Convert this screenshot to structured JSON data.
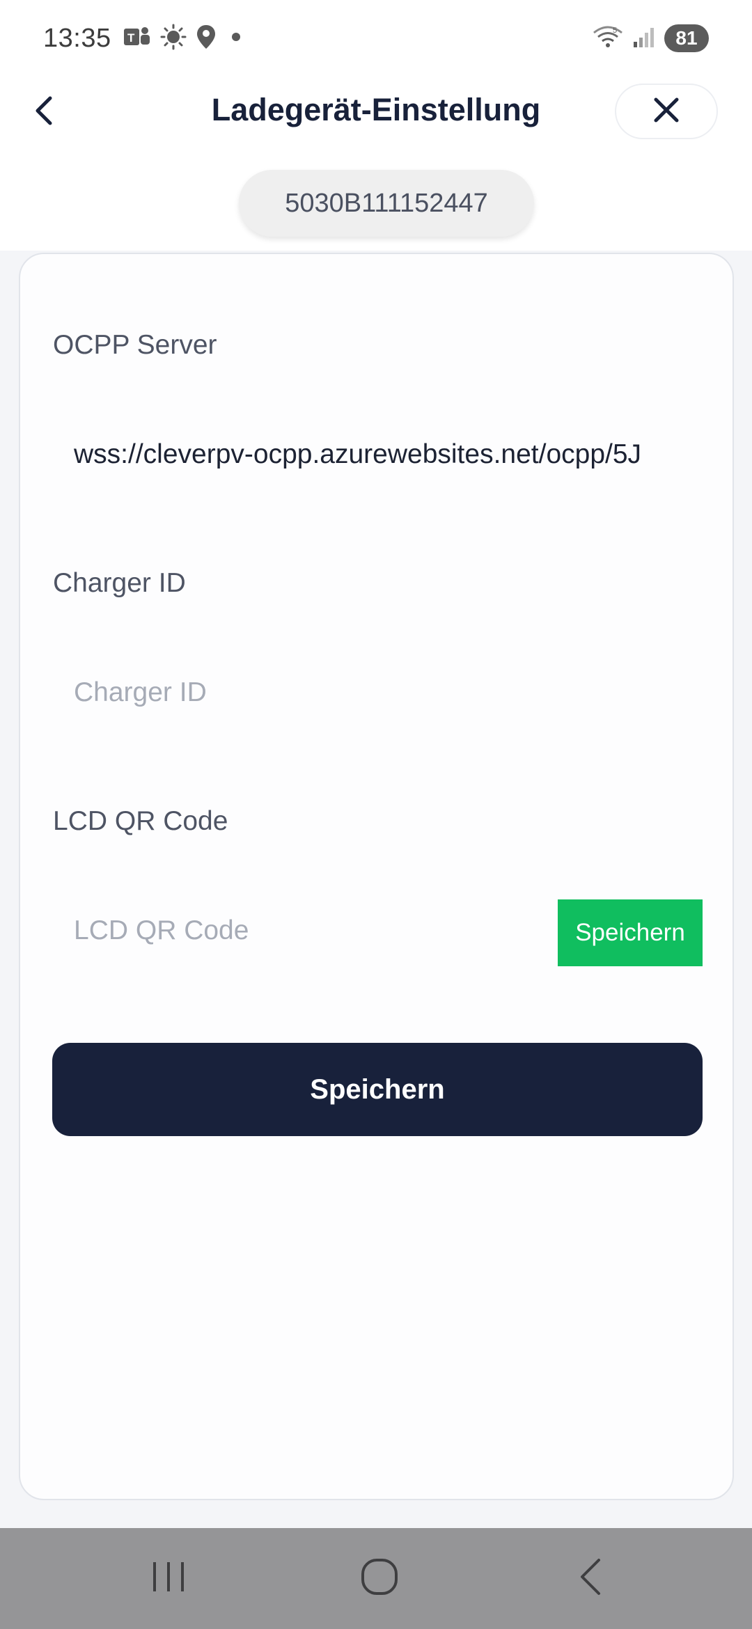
{
  "status_bar": {
    "time": "13:35",
    "battery": "81",
    "icons": [
      "teams-icon",
      "weather-icon",
      "location-icon",
      "notification-dot-icon",
      "wifi-icon",
      "signal-icon"
    ]
  },
  "header": {
    "title": "Ladegerät-Einstellung",
    "device_id": "5030B111152447"
  },
  "form": {
    "ocpp_server": {
      "label": "OCPP Server",
      "value": "wss://cleverpv-ocpp.azurewebsites.net/ocpp/5J"
    },
    "charger_id": {
      "label": "Charger ID",
      "placeholder": "Charger ID"
    },
    "lcd_qr_code": {
      "label": "LCD QR Code",
      "placeholder": "LCD QR Code",
      "button_label": "Speichern"
    },
    "save_label": "Speichern"
  },
  "colors": {
    "accent_green": "#10be5f",
    "primary_navy": "#18213b"
  }
}
